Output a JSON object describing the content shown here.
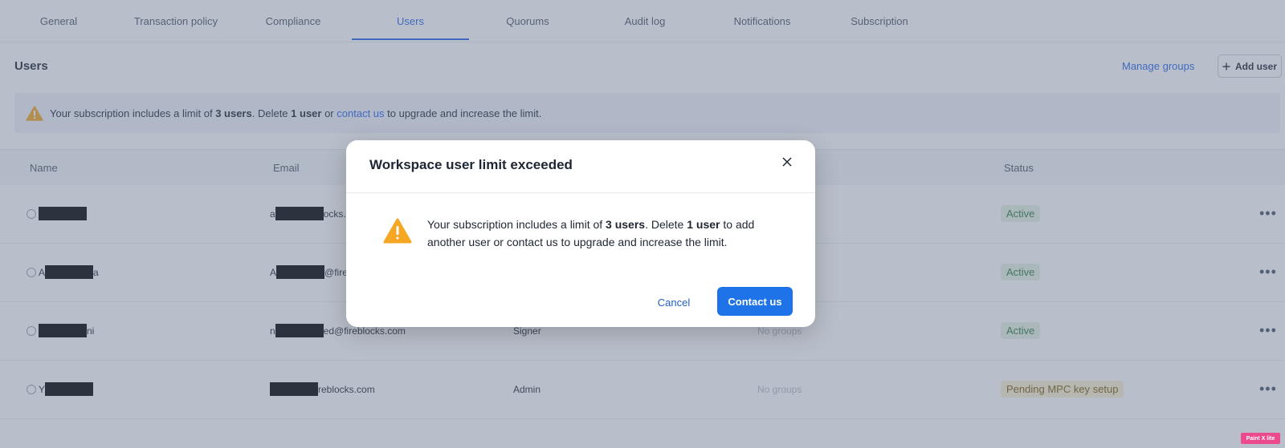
{
  "tabs": [
    {
      "label": "General"
    },
    {
      "label": "Transaction policy"
    },
    {
      "label": "Compliance"
    },
    {
      "label": "Users",
      "active": true
    },
    {
      "label": "Quorums"
    },
    {
      "label": "Audit log"
    },
    {
      "label": "Notifications"
    },
    {
      "label": "Subscription"
    }
  ],
  "section": {
    "title": "Users",
    "manage_groups": "Manage groups",
    "add_user": "Add user",
    "add_user_icon": "plus-icon"
  },
  "banner": {
    "icon": "warning-icon",
    "part1": "Your subscription includes a limit of ",
    "bold1": "3 users",
    "part2": ". Delete ",
    "bold2": "1 user",
    "part3": " or ",
    "link": "contact us",
    "part4": " to upgrade and increase the limit."
  },
  "table": {
    "headers": {
      "name": "Name",
      "email": "Email",
      "status": "Status"
    },
    "rows": [
      {
        "name_prefix": "",
        "name_suffix": "",
        "email_prefix": "a",
        "email_suffix": "ocks.c",
        "role": "",
        "groups": "",
        "status": "Active",
        "status_kind": "ok"
      },
      {
        "name_prefix": "A",
        "name_suffix": "a",
        "email_prefix": "A",
        "email_suffix": "@fire",
        "role": "",
        "groups": "",
        "status": "Active",
        "status_kind": "ok"
      },
      {
        "name_prefix": "",
        "name_suffix": "ni",
        "email_prefix": "n",
        "email_suffix": "ed@fireblocks.com",
        "role": "Signer",
        "groups": "No groups",
        "status": "Active",
        "status_kind": "ok"
      },
      {
        "name_prefix": "Y",
        "name_suffix": "",
        "email_prefix": "",
        "email_suffix": "reblocks.com",
        "role": "Admin",
        "groups": "No groups",
        "status": "Pending MPC key setup",
        "status_kind": "pend"
      }
    ]
  },
  "modal": {
    "title": "Workspace user limit exceeded",
    "close_icon": "close-icon",
    "icon": "warning-icon",
    "msg1": "Your subscription includes a limit of ",
    "bold1": "3 users",
    "msg2": ". Delete ",
    "bold2": "1 user",
    "msg3": " to add another user or contact us to upgrade and increase the limit.",
    "cancel": "Cancel",
    "primary": "Contact us"
  },
  "extension_badge": "Paint X lite",
  "colors": {
    "accent": "#1f73e8",
    "warning": "#f5a623",
    "active_badge": "#e3f3e6",
    "pending_badge": "#fbf1d4"
  }
}
